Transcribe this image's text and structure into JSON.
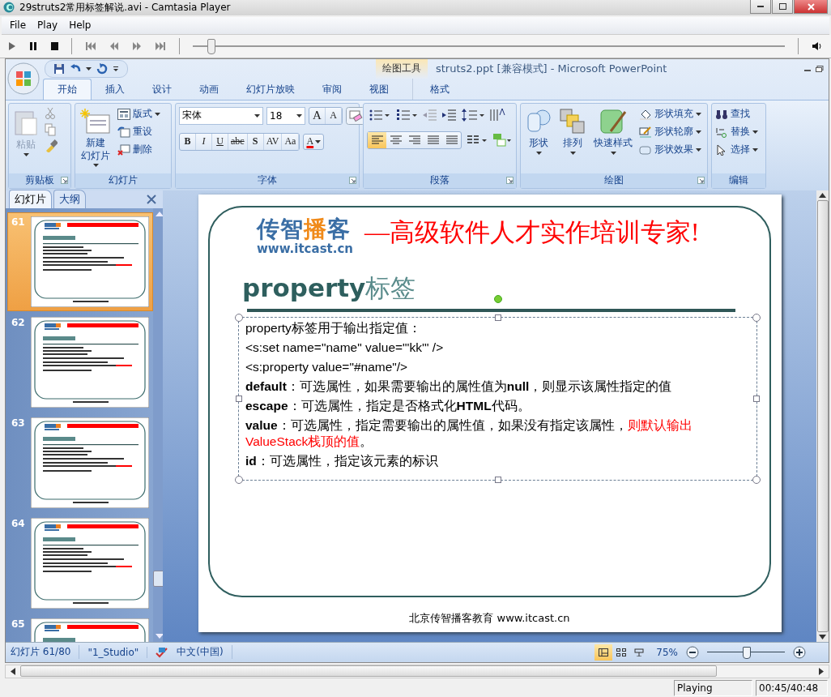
{
  "window": {
    "title": "29struts2常用标签解说.avi - Camtasia Player"
  },
  "menu": [
    "File",
    "Play",
    "Help"
  ],
  "player": {
    "seek": {
      "level": 0.03
    }
  },
  "powerpoint": {
    "title": "struts2.ppt [兼容模式] - Microsoft PowerPoint",
    "contextual_group": "绘图工具",
    "tabs": [
      {
        "label": "开始",
        "selected": true
      },
      {
        "label": "插入",
        "selected": false
      },
      {
        "label": "设计",
        "selected": false
      },
      {
        "label": "动画",
        "selected": false
      },
      {
        "label": "幻灯片放映",
        "selected": false
      },
      {
        "label": "审阅",
        "selected": false
      },
      {
        "label": "视图",
        "selected": false
      }
    ],
    "contextual_tabs": [
      {
        "label": "格式",
        "selected": false
      }
    ],
    "ribbon": {
      "clipboard": {
        "title": "剪贴板",
        "paste": {
          "label": "粘贴",
          "disabled": true
        }
      },
      "slides": {
        "title": "幻灯片",
        "new_slide": [
          "新建",
          "幻灯片"
        ],
        "commands": [
          "版式",
          "重设",
          "删除"
        ]
      },
      "font": {
        "title": "字体",
        "font_name": "宋体",
        "font_size": "18",
        "size_buttons": [
          "A",
          "A"
        ],
        "format_buttons": [
          "B",
          "I",
          "U",
          "abc",
          "S",
          "AV",
          "Aa"
        ],
        "font_color": "A"
      },
      "paragraph": {
        "title": "段落",
        "alignment_buttons": [
          {
            "selected": true
          },
          {
            "selected": false
          },
          {
            "selected": false
          },
          {
            "selected": false
          },
          {
            "selected": false
          }
        ]
      },
      "drawing": {
        "title": "绘图",
        "large": [
          "形状",
          "排列",
          "快速样式"
        ],
        "commands": [
          "形状填充",
          "形状轮廓",
          "形状效果"
        ]
      },
      "editing": {
        "title": "编辑",
        "commands": [
          "查找",
          "替换",
          "选择"
        ]
      }
    },
    "panel": {
      "tabs": [
        {
          "label": "幻灯片",
          "selected": true
        },
        {
          "label": "大纲",
          "selected": false
        }
      ],
      "thumbnails": [
        {
          "number": "61",
          "selected": true
        },
        {
          "number": "62",
          "selected": false
        },
        {
          "number": "63",
          "selected": false
        },
        {
          "number": "64",
          "selected": false
        },
        {
          "number": "65",
          "selected": false
        }
      ]
    },
    "slide": {
      "logo": {
        "parts": [
          {
            "text": "传智",
            "accent": false
          },
          {
            "text": "播",
            "accent": true
          },
          {
            "text": "客",
            "accent": false
          }
        ],
        "url": "www.itcast.cn"
      },
      "tagline": "—高级软件人才实作培训专家!",
      "title": {
        "main": "property",
        "suffix": "标签"
      },
      "lines": [
        {
          "segments": [
            {
              "text": "property标签用于输出指定值：",
              "highlight": false
            }
          ]
        },
        {
          "segments": [
            {
              "text": "<s:set name=\"name\" value=\"'kk'\" />",
              "highlight": false
            }
          ]
        },
        {
          "segments": [
            {
              "text": "<s:property value=\"#name\"/>",
              "highlight": false
            }
          ]
        },
        {
          "segments": [
            {
              "text": "**default**：可选属性，如果需要输出的属性值为**null**，则显示该属性指定的值",
              "highlight": false
            }
          ]
        },
        {
          "segments": [
            {
              "text": "**escape**：可选属性，指定是否格式化**HTML**代码。",
              "highlight": false
            }
          ]
        },
        {
          "segments": [
            {
              "text": "**value**：可选属性，指定需要输出的属性值，如果没有指定该属性，",
              "highlight": false
            },
            {
              "text": "则默认输出ValueStack栈顶的值",
              "highlight": true
            },
            {
              "text": "。",
              "highlight": false
            }
          ]
        },
        {
          "segments": [
            {
              "text": "**id**：可选属性，指定该元素的标识",
              "highlight": false
            }
          ]
        }
      ],
      "footer": "北京传智播客教育 www.itcast.cn"
    },
    "status_bar": {
      "slide": "幻灯片 61/80",
      "theme": "\"1_Studio\"",
      "language": "中文(中国)",
      "views": [
        {
          "selected": true
        },
        {
          "selected": false
        },
        {
          "selected": false
        }
      ],
      "zoom": "75%",
      "zoom_slider": {
        "level": 0.5
      }
    }
  },
  "player_status": {
    "state": "Playing",
    "time": "00:45/40:48"
  }
}
